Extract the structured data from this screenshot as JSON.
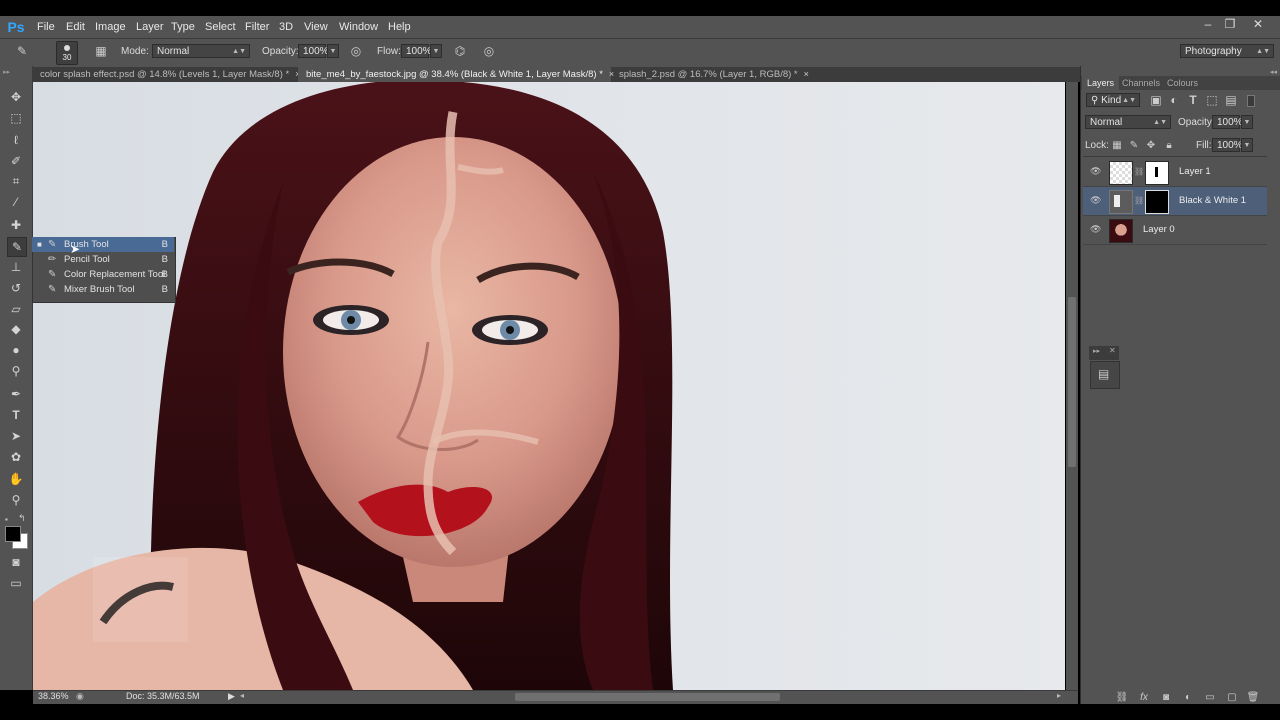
{
  "app": {
    "logo": "Ps"
  },
  "menu": [
    "File",
    "Edit",
    "Image",
    "Layer",
    "Type",
    "Select",
    "Filter",
    "3D",
    "View",
    "Window",
    "Help"
  ],
  "window_controls": {
    "minimize": "–",
    "restore": "❐",
    "close": "✕"
  },
  "options_bar": {
    "brush_size": "30",
    "mode_label": "Mode:",
    "mode_value": "Normal",
    "opacity_label": "Opacity:",
    "opacity_value": "100%",
    "flow_label": "Flow:",
    "flow_value": "100%",
    "workspace": "Photography"
  },
  "tabs": [
    {
      "label": "color splash effect.psd @ 14.8% (Levels 1, Layer Mask/8) *",
      "close": "×"
    },
    {
      "label": "bite_me4_by_faestock.jpg @ 38.4% (Black & White 1, Layer Mask/8) *",
      "close": "×"
    },
    {
      "label": "splash_2.psd @ 16.7% (Layer 1, RGB/8) *",
      "close": "×"
    }
  ],
  "tool_flyout": [
    {
      "label": "Brush Tool",
      "key": "B",
      "icon": "brush-icon"
    },
    {
      "label": "Pencil Tool",
      "key": "B",
      "icon": "pencil-icon"
    },
    {
      "label": "Color Replacement Tool",
      "key": "B",
      "icon": "color-replace-icon"
    },
    {
      "label": "Mixer Brush Tool",
      "key": "B",
      "icon": "mixer-brush-icon"
    }
  ],
  "panel": {
    "tabs": [
      "Layers",
      "Channels",
      "Colours"
    ],
    "filter_kind": "Kind",
    "blend_mode": "Normal",
    "opacity_label": "Opacity:",
    "opacity_value": "100%",
    "lock_label": "Lock:",
    "fill_label": "Fill:",
    "fill_value": "100%",
    "layers": [
      {
        "name": "Layer 1"
      },
      {
        "name": "Black & White 1"
      },
      {
        "name": "Layer 0"
      }
    ]
  },
  "status": {
    "zoom": "38.36%",
    "doc": "Doc: 35.3M/63.5M"
  }
}
